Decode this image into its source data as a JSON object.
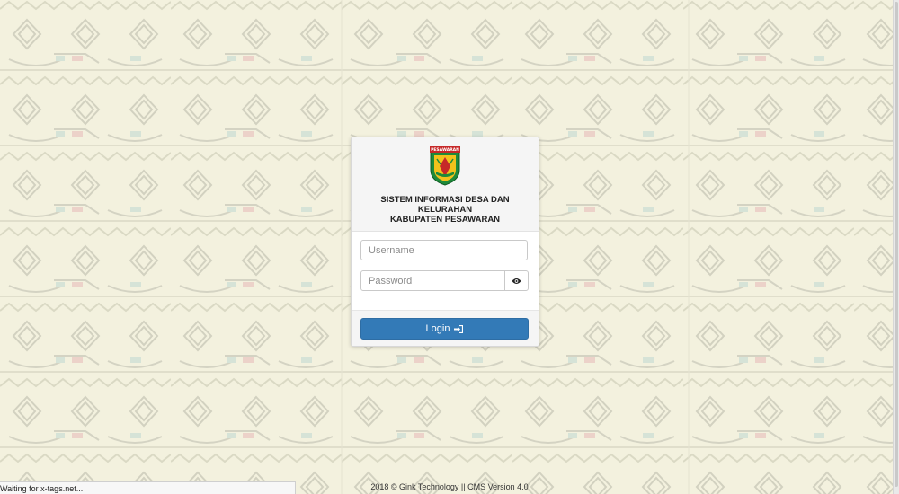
{
  "login": {
    "title_lines": [
      "SISTEM INFORMASI DESA DAN",
      "KELURAHAN",
      "KABUPATEN PESAWARAN"
    ],
    "logo_text": "PESAWARAN",
    "username_placeholder": "Username",
    "password_placeholder": "Password",
    "login_label": "Login",
    "eye_icon": "eye-icon",
    "signin_icon": "sign-in-icon"
  },
  "footer": {
    "text": "2018 © Gink Technology || CMS Version 4.0"
  },
  "status_bar": {
    "text": "Waiting for x-tags.net..."
  },
  "colors": {
    "primary": "#337ab7",
    "background": "#f3f1de",
    "logo_green": "#1e8a3a",
    "logo_red": "#c62828",
    "logo_yellow": "#f2c21b"
  }
}
